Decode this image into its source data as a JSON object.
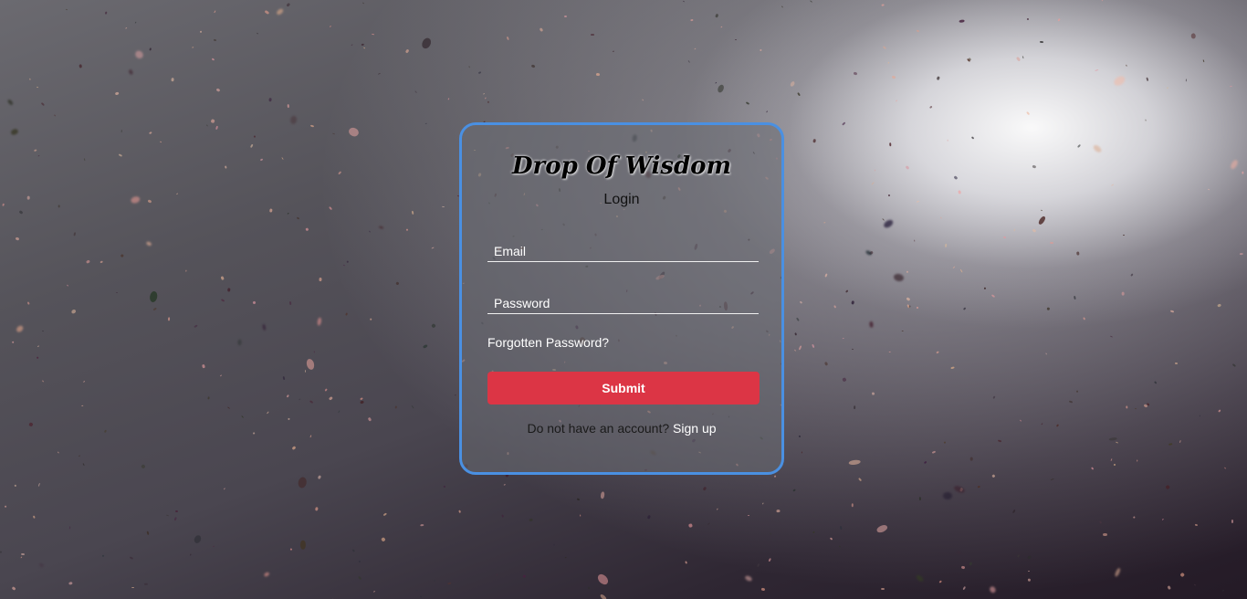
{
  "login_card": {
    "title": "Drop Of Wisdom",
    "subtitle": "Login",
    "email_placeholder": "Email",
    "email_value": "",
    "password_placeholder": "Password",
    "password_value": "",
    "forgot_label": "Forgotten Password?",
    "submit_label": "Submit",
    "signup_prompt": "Do not have an account?",
    "signup_link": "Sign up"
  },
  "colors": {
    "card_border": "#4a90e2",
    "submit_bg": "#dc3545",
    "card_bg": "rgba(105,108,114,0.55)"
  }
}
